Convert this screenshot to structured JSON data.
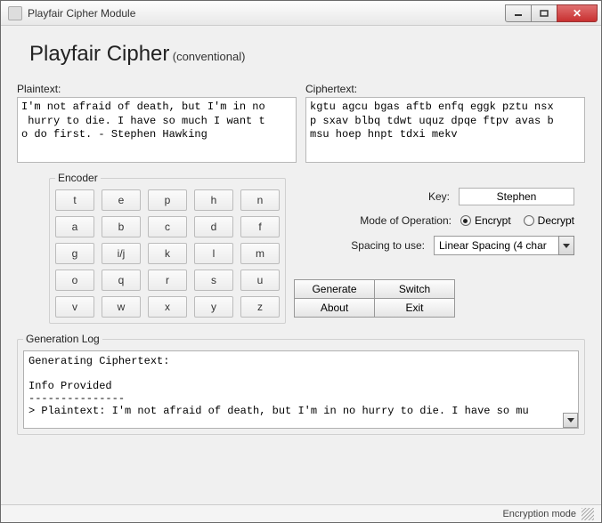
{
  "window": {
    "title": "Playfair Cipher Module"
  },
  "header": {
    "title": "Playfair Cipher",
    "subtitle": "(conventional)"
  },
  "plaintext": {
    "label": "Plaintext:",
    "value": "I'm not afraid of death, but I'm in no\n hurry to die. I have so much I want t\no do first. - Stephen Hawking"
  },
  "ciphertext": {
    "label": "Ciphertext:",
    "value": "kgtu agcu bgas aftb enfq eggk pztu nsx\np sxav blbq tdwt uquz dpqe ftpv avas b\nmsu hoep hnpt tdxi mekv"
  },
  "encoder": {
    "label": "Encoder",
    "cells": [
      "t",
      "e",
      "p",
      "h",
      "n",
      "a",
      "b",
      "c",
      "d",
      "f",
      "g",
      "i/j",
      "k",
      "l",
      "m",
      "o",
      "q",
      "r",
      "s",
      "u",
      "v",
      "w",
      "x",
      "y",
      "z"
    ]
  },
  "controls": {
    "key_label": "Key:",
    "key_value": "Stephen",
    "mode_label": "Mode of Operation:",
    "mode_options": {
      "encrypt": "Encrypt",
      "decrypt": "Decrypt"
    },
    "mode_selected": "encrypt",
    "spacing_label": "Spacing to use:",
    "spacing_value": "Linear Spacing (4 char"
  },
  "buttons": {
    "generate": "Generate",
    "switch": "Switch",
    "about": "About",
    "exit": "Exit"
  },
  "log": {
    "label": "Generation Log",
    "text": "Generating Ciphertext:\n\nInfo Provided\n---------------\n> Plaintext: I'm not afraid of death, but I'm in no hurry to die. I have so mu"
  },
  "status": {
    "right": "Encryption mode"
  }
}
